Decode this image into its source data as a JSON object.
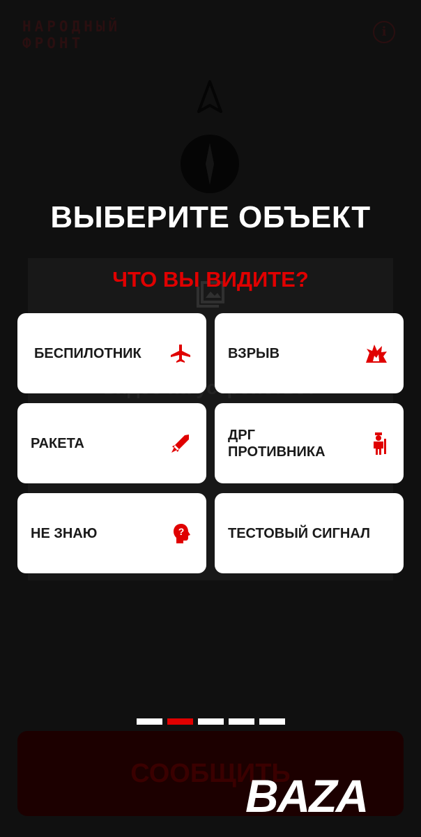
{
  "header": {
    "logo_line1": "НАРОДНЫЙ",
    "logo_line2": "ФРОНТ",
    "info_label": "i"
  },
  "background": {
    "text": "видео на устройстве?"
  },
  "title": "ВЫБЕРИТЕ ОБЪЕКТ",
  "question": "ЧТО ВЫ ВИДИТЕ?",
  "options": [
    {
      "label": "БЕСПИЛОТНИК",
      "icon": "airplane-icon"
    },
    {
      "label": "ВЗРЫВ",
      "icon": "explosion-icon"
    },
    {
      "label": "РАКЕТА",
      "icon": "rocket-icon"
    },
    {
      "label": "ДРГ\nПРОТИВНИКА",
      "icon": "soldier-icon"
    },
    {
      "label": "НЕ ЗНАЮ",
      "icon": "question-head-icon"
    },
    {
      "label": "ТЕСТОВЫЙ СИГНАЛ",
      "icon": ""
    }
  ],
  "pagination": {
    "total": 5,
    "current": 2
  },
  "submit_label": "СООБЩИТЬ",
  "watermark": "BAZA",
  "colors": {
    "accent": "#e00000",
    "background": "#101010",
    "card": "#ffffff"
  }
}
